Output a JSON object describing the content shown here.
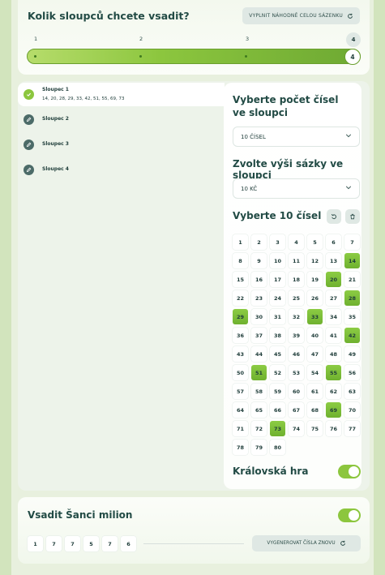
{
  "columns_section": {
    "title": "Kolik sloupců chcete vsadit?",
    "random_fill_label": "VYPLNIT NÁHODNĚ CELOU SÁZENKU",
    "steps": [
      "1",
      "2",
      "3",
      "4"
    ],
    "selected_count": "4",
    "slider_value": 4
  },
  "columns": [
    {
      "name": "Sloupec 1",
      "numbers": "14, 20, 28, 29, 33, 42, 51, 55, 69, 73",
      "done": true
    },
    {
      "name": "Sloupec 2"
    },
    {
      "name": "Sloupec 3"
    },
    {
      "name": "Sloupec 4"
    }
  ],
  "count_select": {
    "title": "Vyberte počet čísel ve sloupci",
    "value": "10 ČÍSEL"
  },
  "bet_select": {
    "title": "Zvolte výši sázky ve sloupci",
    "value": "10 KČ"
  },
  "picker": {
    "title": "Vyberte 10 čísel",
    "numbers": [
      1,
      2,
      3,
      4,
      5,
      6,
      7,
      8,
      9,
      10,
      11,
      12,
      13,
      14,
      15,
      16,
      17,
      18,
      19,
      20,
      21,
      22,
      23,
      24,
      25,
      26,
      27,
      28,
      29,
      30,
      31,
      32,
      33,
      34,
      35,
      36,
      37,
      38,
      39,
      40,
      41,
      42,
      43,
      44,
      45,
      46,
      47,
      48,
      49,
      50,
      51,
      52,
      53,
      54,
      55,
      56,
      57,
      58,
      59,
      60,
      61,
      62,
      63,
      64,
      65,
      66,
      67,
      68,
      69,
      70,
      71,
      72,
      73,
      74,
      75,
      76,
      77,
      78,
      79,
      80
    ],
    "selected": [
      14,
      20,
      28,
      29,
      33,
      42,
      51,
      55,
      69,
      73
    ]
  },
  "kralovska_hra": {
    "label": "Královská hra",
    "enabled": true
  },
  "sance": {
    "title": "Vsadit Šanci milion",
    "enabled": true,
    "digits": [
      "1",
      "7",
      "7",
      "5",
      "7",
      "6"
    ],
    "regenerate_label": "VYGENEROVAT ČÍSLA ZNOVU"
  },
  "colors": {
    "accent": "#8cc63e",
    "text": "#1f3d3a",
    "background": "#e8f0de"
  },
  "icons": [
    "refresh-icon",
    "check-icon",
    "pencil-icon",
    "chevron-down-icon",
    "undo-icon",
    "trash-icon"
  ]
}
